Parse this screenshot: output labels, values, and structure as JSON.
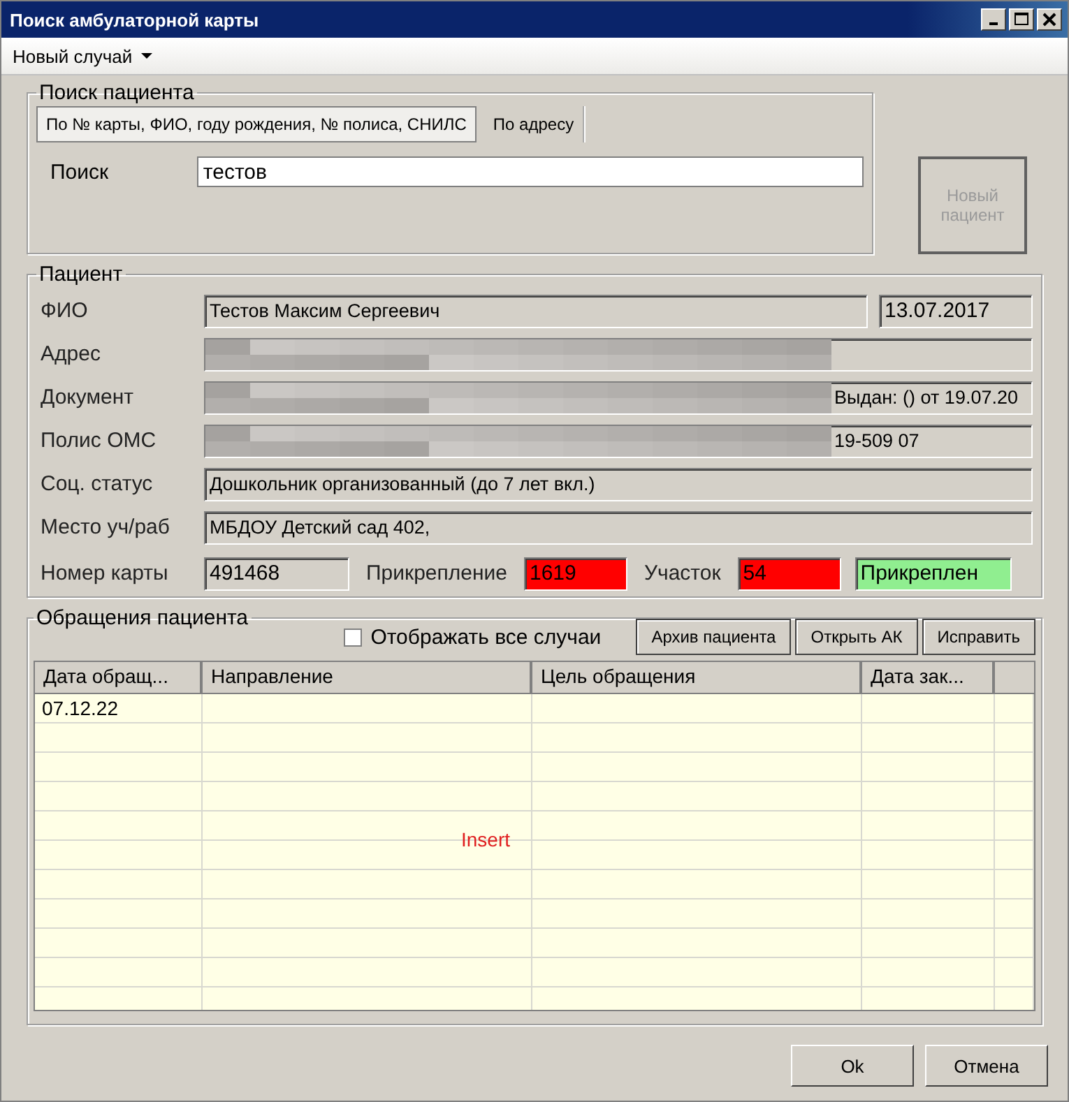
{
  "window": {
    "title": "Поиск амбулаторной карты"
  },
  "menu": [
    {
      "label": "Новый случай",
      "has_dropdown": true
    }
  ],
  "search": {
    "title": "Поиск пациента",
    "tabs": [
      {
        "label": "По № карты, ФИО, году рождения, № полиса, СНИЛС",
        "selected": true
      },
      {
        "label": "По адресу",
        "selected": false
      }
    ],
    "label": "Поиск",
    "value": "тестов"
  },
  "new_patient_button": {
    "label": "Новый пациент",
    "disabled": true
  },
  "patient": {
    "title": "Пациент",
    "fields": [
      {
        "label": "ФИО",
        "value": "Тестов Максим Сергеевич",
        "extra": "13.07.2017",
        "redacted": false
      },
      {
        "label": "Адрес",
        "redacted": true
      },
      {
        "label": "Документ",
        "value": "Выдан: () от 19.07.20",
        "redacted": true
      },
      {
        "label": "Полис ОМС",
        "value": "19-509 07",
        "redacted": true
      },
      {
        "label": "Соц. статус",
        "value": "Дошкольник организованный (до 7 лет вкл.)",
        "redacted": false
      },
      {
        "label": "Место уч/раб",
        "value": "МБДОУ Детский сад 402,",
        "redacted": false
      }
    ],
    "card": {
      "label": "Номер карты",
      "value": "491468"
    },
    "attachment": {
      "label": "Прикрепление",
      "value": "1619",
      "color": "#ff0000"
    },
    "district": {
      "label": "Участок",
      "value": "54",
      "color": "#ff0000"
    },
    "status": {
      "value": "Прикреплен",
      "color": "#90ee90"
    }
  },
  "appeals": {
    "title": "Обращения пациента",
    "show_all": {
      "label": "Отображать все случаи",
      "checked": false
    },
    "buttons": [
      "Архив пациента",
      "Открыть АК",
      "Исправить"
    ],
    "table": {
      "columns": [
        "Дата обращ...",
        "Направление",
        "Цель обращения",
        "Дата зак..."
      ],
      "rows": [
        {
          "cells": [
            "07.12.22"
          ]
        }
      ],
      "overlay_text": "Insert"
    }
  },
  "buttons": [
    "Ok",
    "Отмена"
  ]
}
